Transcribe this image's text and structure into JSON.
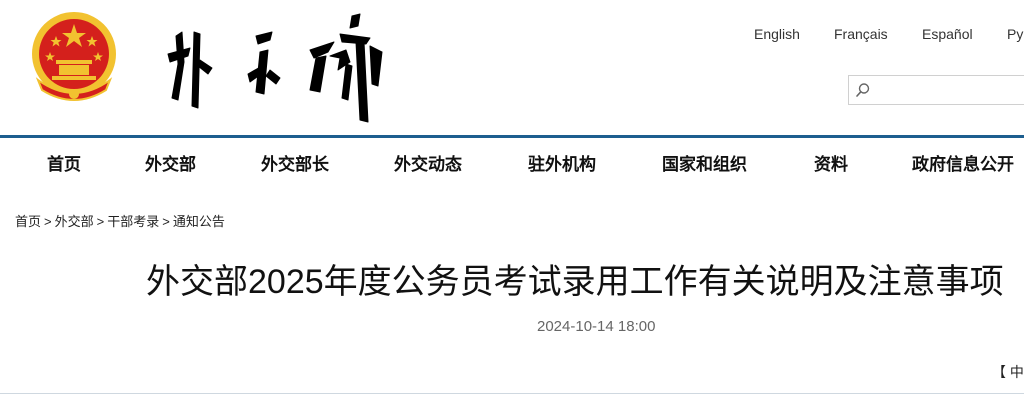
{
  "header": {
    "languages": [
      {
        "label": "English"
      },
      {
        "label": "Français"
      },
      {
        "label": "Español"
      },
      {
        "label": "Ру"
      }
    ],
    "search": {
      "placeholder": ""
    }
  },
  "nav": {
    "items": [
      {
        "label": "首页"
      },
      {
        "label": "外交部"
      },
      {
        "label": "外交部长"
      },
      {
        "label": "外交动态"
      },
      {
        "label": "驻外机构"
      },
      {
        "label": "国家和组织"
      },
      {
        "label": "资料"
      },
      {
        "label": "政府信息公开"
      }
    ]
  },
  "breadcrumb": {
    "items": [
      "首页",
      "外交部",
      "干部考录",
      "通知公告"
    ],
    "separator": ">"
  },
  "article": {
    "title": "外交部2025年度公务员考试录用工作有关说明及注意事项",
    "date": "2024-10-14 18:00",
    "font_size_control": "【 中"
  },
  "colors": {
    "accent": "#1d5e8f",
    "emblem_red": "#d4201c",
    "emblem_gold": "#f2c230"
  }
}
